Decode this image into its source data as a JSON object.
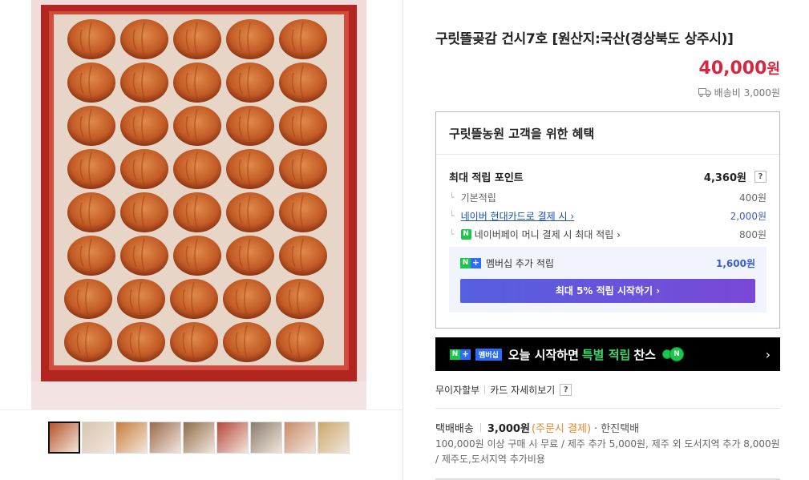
{
  "product": {
    "title": "구릿뜰곶감 건시7호 [원산지:국산(경상북도 상주시)]",
    "price": "40,000",
    "price_unit": "원",
    "shipping": "배송비 3,000원"
  },
  "benefit": {
    "heading": "구릿뜰농원 고객을 위한 혜택",
    "max_points_label": "최대 적립 포인트",
    "max_points_value": "4,360원",
    "help": "?",
    "rows": [
      {
        "label": "기본적립",
        "value": "400원"
      },
      {
        "label": "네이버 현대카드로 결제 시 ›",
        "value": "2,000원"
      },
      {
        "label": "네이버페이 머니 결제 시 최대 적립 ›",
        "value": "800원"
      }
    ],
    "membership_label": "멤버십 추가 적립",
    "membership_value": "1,600원",
    "membership_button": "최대 5% 적립 시작하기 ›"
  },
  "banner": {
    "tag": "멤버십",
    "text_before": "오늘 시작하면",
    "highlight": "특별 적립",
    "text_after": "찬스",
    "arrow": "›"
  },
  "installment": {
    "label1": "무이자할부",
    "label2": "카드 자세히보기",
    "help": "?"
  },
  "delivery": {
    "label": "택배배송",
    "fee": "3,000원",
    "note": "(주문시 결제)",
    "carrier": "· 한진택배",
    "desc": "100,000원 이상 구매 시 무료 / 제주 추가 5,000원, 제주 외 도서지역 추가 8,000원 / 제주도,도서지역 추가비용"
  },
  "thumbnails": [
    "thumb-1",
    "thumb-2",
    "thumb-3",
    "thumb-4",
    "thumb-5",
    "thumb-6",
    "thumb-7",
    "thumb-8",
    "thumb-9"
  ],
  "colors": {
    "price_red": "#d7263d",
    "naver_green": "#19c84b",
    "link_blue": "#1a4fb8",
    "membership_gradient_start": "#5560e0",
    "membership_gradient_end": "#7a48d6"
  },
  "icons": {
    "truck": "truck-icon",
    "naver_n": "naver-n-icon",
    "naverpay_plus": "plus-icon",
    "coins": "coin-icon"
  }
}
